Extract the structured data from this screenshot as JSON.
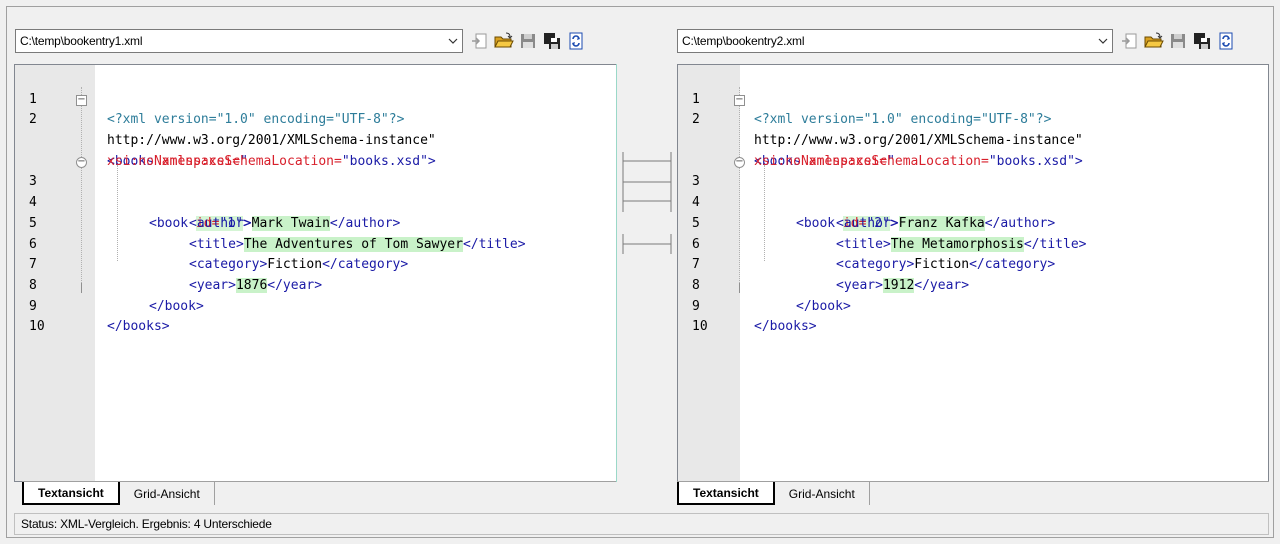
{
  "left": {
    "path": "C:\\temp\\bookentry1.xml",
    "tabs": [
      "Textansicht",
      "Grid-Ansicht"
    ],
    "lines": [
      {
        "n": "1"
      },
      {
        "n": "2"
      },
      {
        "n": ""
      },
      {
        "n": ""
      },
      {
        "n": "3"
      },
      {
        "n": "4"
      },
      {
        "n": "5"
      },
      {
        "n": "6"
      },
      {
        "n": "7"
      },
      {
        "n": "8"
      },
      {
        "n": "9"
      },
      {
        "n": "10"
      }
    ],
    "code": {
      "l1": "<?xml version=\"1.0\" encoding=\"UTF-8\"?>",
      "l2_tag": "<books",
      "l2_attr": "xmlns:xsi=",
      "l2_val": "\"",
      "l2b": "http://www.w3.org/2001/XMLSchema-instance\"",
      "l2c_attr": "xsi:noNamespaceSchemaLocation=",
      "l2c_val": "\"books.xsd\">",
      "l3_tag": "<book",
      "l3_attr": "id=",
      "l3_val": "\"1\"",
      "l3_end": ">",
      "l4_open": "<author>",
      "l4_text": "Mark Twain",
      "l4_close": "</author>",
      "l5_open": "<title>",
      "l5_text": "The Adventures of Tom Sawyer",
      "l5_close": "</title>",
      "l6_open": "<category>",
      "l6_text": "Fiction",
      "l6_close": "</category>",
      "l7_open": "<year>",
      "l7_text": "1876",
      "l7_close": "</year>",
      "l8": "</book>",
      "l9": "</books>"
    }
  },
  "right": {
    "path": "C:\\temp\\bookentry2.xml",
    "tabs": [
      "Textansicht",
      "Grid-Ansicht"
    ],
    "code": {
      "l1": "<?xml version=\"1.0\" encoding=\"UTF-8\"?>",
      "l2_tag": "<books",
      "l2_attr": "xmlns:xsi=",
      "l2_val": "\"",
      "l2b": "http://www.w3.org/2001/XMLSchema-instance\"",
      "l2c_attr": "xsi:noNamespaceSchemaLocation=",
      "l2c_val": "\"books.xsd\">",
      "l3_tag": "<book",
      "l3_attr": "id=",
      "l3_val": "\"2\"",
      "l3_end": ">",
      "l4_open": "<author>",
      "l4_text": "Franz Kafka",
      "l4_close": "</author>",
      "l5_open": "<title>",
      "l5_text": "The Metamorphosis",
      "l5_close": "</title>",
      "l6_open": "<category>",
      "l6_text": "Fiction",
      "l6_close": "</category>",
      "l7_open": "<year>",
      "l7_text": "1912",
      "l7_close": "</year>",
      "l8": "</book>",
      "l9": "</books>"
    }
  },
  "line_numbers": [
    "1",
    "2",
    "3",
    "4",
    "5",
    "6",
    "7",
    "8",
    "9",
    "10"
  ],
  "toolbar_icons": [
    "load-icon",
    "open-folder-icon",
    "save-icon",
    "save-as-icon",
    "refresh-icon"
  ],
  "status": "Status: XML-Vergleich. Ergebnis: 4 Unterschiede",
  "colors": {
    "diff_highlight": "#c9f2c9",
    "tag": "#1a1aa6",
    "attribute": "#d8202c",
    "connector": "#9ad8c8"
  }
}
